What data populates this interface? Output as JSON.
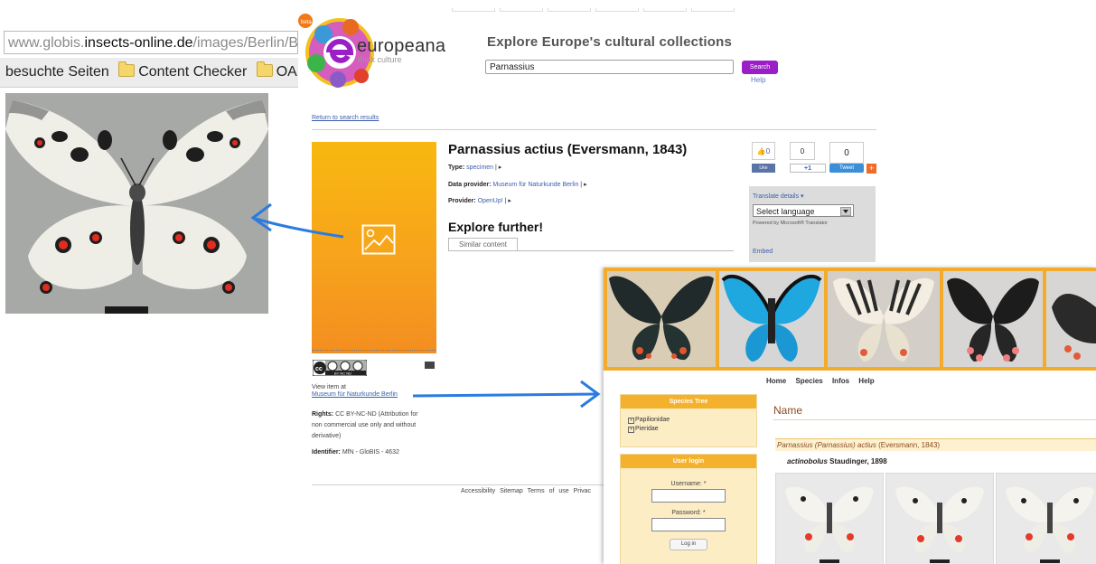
{
  "browser": {
    "address_prefix": "www.globis.",
    "address_host": "insects-online.de",
    "address_suffix": "/images/Berlin/Ber",
    "bookmarks": [
      "besuchte Seiten",
      "Content Checker",
      "OAI T"
    ]
  },
  "europeana": {
    "logo_text": "europeana",
    "logo_tagline": "think culture",
    "headline": "Explore Europe's cultural collections",
    "search_value": "Parnassius",
    "search_button": "Search",
    "help": "Help",
    "back_link": "Return to search results",
    "title": "Parnassius actius (Eversmann, 1843)",
    "meta": [
      {
        "label": "Type:",
        "value": "specimen",
        "sep": " |  ▸"
      },
      {
        "label": "Data provider:",
        "value": "Museum für Naturkunde Berlin",
        "sep": " |  ▸"
      },
      {
        "label": "Provider:",
        "value": "OpenUp!",
        "sep": " |  ▸"
      }
    ],
    "explore_heading": "Explore further!",
    "tab_similar": "Similar content",
    "view_item_at": "View item at",
    "museum_link": "Museum für Naturkunde Berlin",
    "rights_label": "Rights:",
    "rights_text": "CC BY-NC-ND (Attribution for non commercial use only and without derivative)",
    "identifier_label": "Identifier:",
    "identifier_value": "MfN - GloBIS - 4632",
    "license_badge": "BY NC ND",
    "social": {
      "like_count": "0",
      "plus_count": "0",
      "tweet_count": "0",
      "like": "Like",
      "plus": "+1",
      "tweet": "Tweet",
      "add": "+"
    },
    "translate": {
      "title": "Translate details ▾",
      "select": "Select language",
      "powered": "Powered by Microsoft® Translator",
      "embed": "Embed"
    },
    "footer": "Accessibility  Sitemap  Terms of use  Privac"
  },
  "globis": {
    "nav": [
      "Home",
      "Species",
      "Infos",
      "Help"
    ],
    "species_tree_title": "Species Tree",
    "tree_items": [
      "Papilionidae",
      "Pieridae"
    ],
    "login_title": "User login",
    "username_label": "Username: *",
    "password_label": "Password: *",
    "login_button": "Log in",
    "name_heading": "Name",
    "taxon_italic": "Parnassius (Parnassius) actius",
    "taxon_author": "(Eversmann, 1843)",
    "subspecies_italic": "actinobolus",
    "subspecies_author": "Staudinger, 1898"
  },
  "colors": {
    "europeana_purple": "#9b1fc7",
    "thumbnail_orange": "#f7a31c",
    "globis_orange": "#f2ab2b",
    "arrow_blue": "#2b7be0"
  }
}
